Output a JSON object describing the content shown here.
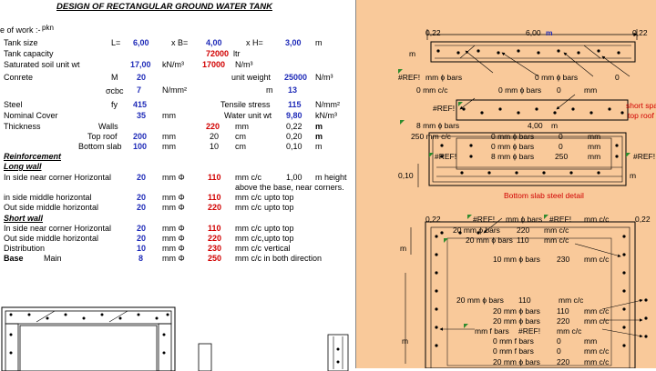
{
  "title": "DESIGN  OF RECTANGULAR GROUND  WATER TANK",
  "header": {
    "nature": "e of work :-",
    "pkn": "pkn"
  },
  "rows": {
    "tank_size": {
      "label": "Tank size",
      "l_lbl": "L=",
      "l_val": "6,00",
      "b_lbl": "x  B=",
      "b_val": "4,00",
      "h_lbl": "x   H=",
      "h_val": "3,00",
      "unit": "m"
    },
    "capacity": {
      "label": "Tank capacity",
      "val": "72000",
      "unit": "ltr"
    },
    "soil": {
      "label": "Saturated soil unit wt",
      "val": "17,00",
      "unit": "kN/m³",
      "val2": "17000",
      "unit2": "N/m³"
    },
    "concrete": {
      "label": "Conrete",
      "m_lbl": "M",
      "m_val": "20",
      "uw_lbl": "unit weight",
      "uw_val": "25000",
      "uw_unit": "N/m³"
    },
    "cbc": {
      "sym": "σcbc",
      "val": "7",
      "unit": "N/mm²",
      "m_lbl": "m",
      "m_val": "13"
    },
    "steel": {
      "label": "Steel",
      "fy_lbl": "fy",
      "fy_val": "415",
      "ts_lbl": "Tensile stress",
      "ts_val": "115",
      "ts_unit": "N/mm²"
    },
    "cover": {
      "label": "Nominal  Cover",
      "val": "35",
      "unit": "mm",
      "ww_lbl": "Water unit wt",
      "ww_val": "9,80",
      "ww_unit": "kN/m³"
    },
    "thickness": {
      "label": "Thickness",
      "walls_lbl": "Walls",
      "walls_val": "220",
      "walls_unit": "mm",
      "walls_m": "0,22",
      "walls_mu": "m"
    },
    "toproof": {
      "label": "Top roof",
      "val": "200",
      "unit": "mm",
      "v2": "20",
      "u2": "cm",
      "v3": "0,20",
      "u3": "m"
    },
    "bottom": {
      "label": "Bottom slab",
      "val": "100",
      "unit": "mm",
      "v2": "10",
      "u2": "cm",
      "v3": "0,10",
      "u3": "m"
    }
  },
  "reinforcement": "Reinforcement",
  "long_wall": "Long wall",
  "short_wall": "Short wall",
  "lw": [
    {
      "label": "In side  near corner Horizontal",
      "d": "20",
      "u": "mm Φ",
      "s": "110",
      "su": "mm c/c",
      "x": "1,00",
      "xu": "m height"
    },
    {
      "label": "",
      "d": "",
      "u": "",
      "s": "",
      "su": "above the base, near corners.",
      "x": "",
      "xu": ""
    },
    {
      "label": "in side middle horizontal",
      "d": "20",
      "u": "mm Φ",
      "s": "110",
      "su": "mm c/c",
      "x": "upto top",
      "xu": ""
    },
    {
      "label": "Out side middle horizontal",
      "d": "20",
      "u": "mm Φ",
      "s": "220",
      "su": "mm c/c",
      "x": "upto top",
      "xu": ""
    }
  ],
  "sw": [
    {
      "label": "In side  near corner Horizontal",
      "d": "20",
      "u": "mm Φ",
      "s": "110",
      "su": "mm c/c",
      "x": "upto top"
    },
    {
      "label": "Out side middle horizontal",
      "d": "20",
      "u": "mm Φ",
      "s": "220",
      "su": "mm c/c,",
      "x": "upto top"
    },
    {
      "label": "Distribution",
      "d": "10",
      "u": "mm Φ",
      "s": "230",
      "su": "mm c/c",
      "x": "vertical"
    }
  ],
  "base": {
    "label": "Base",
    "main": "Main",
    "d": "8",
    "u": "mm Φ",
    "s": "250",
    "su": "mm c/c in both direction"
  },
  "right": {
    "top_dim_l": "0,22",
    "top_dim_mid": "6,00",
    "top_dim_m": "m",
    "top_dim_r": "0,22",
    "m1": "m",
    "ref1": "#REF!",
    "bars1": "mm ɸ bars",
    "bars1b": "0  mm ɸ bars",
    "bars1c": "0",
    "cc1": "0  mm c/c",
    "bars2": "0  mm ɸ bars",
    "bars2b": "0",
    "bars2c": "mm",
    "ref2": "#REF!",
    "short_span": "short spa",
    "top_roof": "top roof",
    "v1": "8  mm ɸ bars",
    "v1b": "4,00",
    "v1c": "m",
    "v2": "250  mm c/c",
    "v2b": "0  mm ɸ bars",
    "v2c": "0",
    "v2d": "mm",
    "v3": "0  mm ɸ bars",
    "v3b": "0",
    "v3c": "mm",
    "ref3": "#REF!",
    "v4": "8  mm ɸ bars",
    "v4b": "250",
    "v4c": "mm",
    "ref4": "#REF!",
    "d010": "0,10",
    "m2": "m",
    "bottom_caption": "Bottom slab steel detail",
    "p_l": "0,22",
    "p_ref": "#REF!",
    "p_bars": "mm ɸ bars",
    "p_ref2": "#REF!",
    "p_cc": "mm c/c",
    "p_r": "0,22",
    "p2": "20  mm ɸ bars",
    "p2b": "220",
    "p2c": "mm c/c",
    "p3": "20  mm ɸ bars",
    "p3b": "110",
    "p3c": "mm c/c",
    "p4": "10  mm ɸ bars",
    "p4b": "230",
    "p4c": "mm c/c",
    "pm": "m",
    "q1": "20  mm ɸ bars",
    "q1b": "110",
    "q1c": "mm c/c",
    "q2": "20  mm ɸ bars",
    "q2b": "110",
    "q2c": "mm c/c",
    "q3": "20  mm ɸ bars",
    "q3b": "220",
    "q3c": "mm c/c",
    "q4": "mm f bars",
    "q4b": "#REF!",
    "q4c": "mm c/c",
    "q5": "0  mm f bars",
    "q5b": "0",
    "q5c": "mm",
    "q6": "0  mm f bars",
    "q6b": "0",
    "q6c": "mm c/c",
    "q7": "20  mm ɸ bars",
    "q7b": "220",
    "q7c": "mm c/c",
    "qm": "m"
  }
}
